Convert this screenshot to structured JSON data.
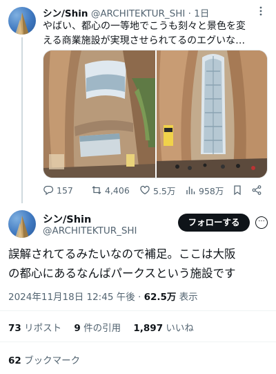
{
  "tweet1": {
    "display_name": "シン/Shin",
    "handle": "@ARCHITEKTUR_SHI",
    "separator": "·",
    "time": "1日",
    "text_line1": "やばい、都心の一等地でこうも刻々と景色を変",
    "text_line2": "える商業施設が実現させられてるのエグいな…",
    "actions": {
      "replies": "157",
      "reposts": "4,406",
      "likes": "5.5万",
      "views": "958万"
    }
  },
  "tweet2": {
    "display_name": "シン/Shin",
    "handle": "@ARCHITEKTUR_SHI",
    "follow_label": "フォローする",
    "text_line1": "誤解されてるみたいなので補足。ここは大阪",
    "text_line2": "の都心にあるなんばパークスという施設です",
    "timestamp": "2024年11月18日 12:45 午後",
    "meta_sep": " · ",
    "views_value": "62.5万",
    "views_label": " 表示",
    "reposts_count": "73",
    "reposts_label": " リポスト",
    "quotes_count": "9",
    "quotes_label": " 件の引用",
    "likes_count": "1,897",
    "likes_label": " いいね",
    "bookmarks_count": "62",
    "bookmarks_label": " ブックマーク"
  },
  "colors": {
    "text": "#0f1419",
    "secondary": "#536471",
    "follow_button": "#0f1419",
    "divider": "#eff3f4"
  },
  "icons": [
    "reply-icon",
    "repost-icon",
    "like-icon",
    "views-icon",
    "bookmark-icon",
    "share-icon",
    "more-icon"
  ]
}
